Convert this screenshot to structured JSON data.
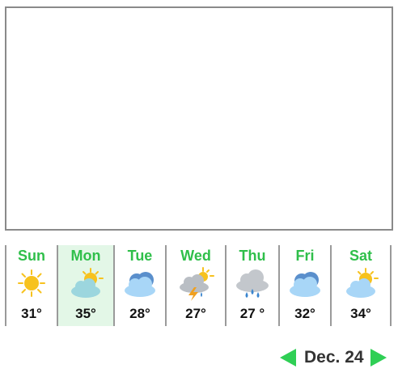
{
  "forecast": {
    "selected_index": 1,
    "days": [
      {
        "name": "Sun",
        "temp": "31°",
        "icon": "sun-icon"
      },
      {
        "name": "Mon",
        "temp": "35°",
        "icon": "partly-cloudy-icon"
      },
      {
        "name": "Tue",
        "temp": "28°",
        "icon": "cloud-icon"
      },
      {
        "name": "Wed",
        "temp": "27°",
        "icon": "thunderstorm-icon"
      },
      {
        "name": "Thu",
        "temp": "27 °",
        "icon": "rain-icon"
      },
      {
        "name": "Fri",
        "temp": "32°",
        "icon": "cloud-icon"
      },
      {
        "name": "Sat",
        "temp": "34°",
        "icon": "partly-cloudy-icon"
      }
    ]
  },
  "date_nav": {
    "label": "Dec. 24"
  },
  "colors": {
    "accent_green": "#2fcf55",
    "day_name_green": "#2fbf4a",
    "selected_bg": "#e3f7e7",
    "sun_yellow": "#f7c21e",
    "cloud_blue": "#9dd0f5"
  }
}
